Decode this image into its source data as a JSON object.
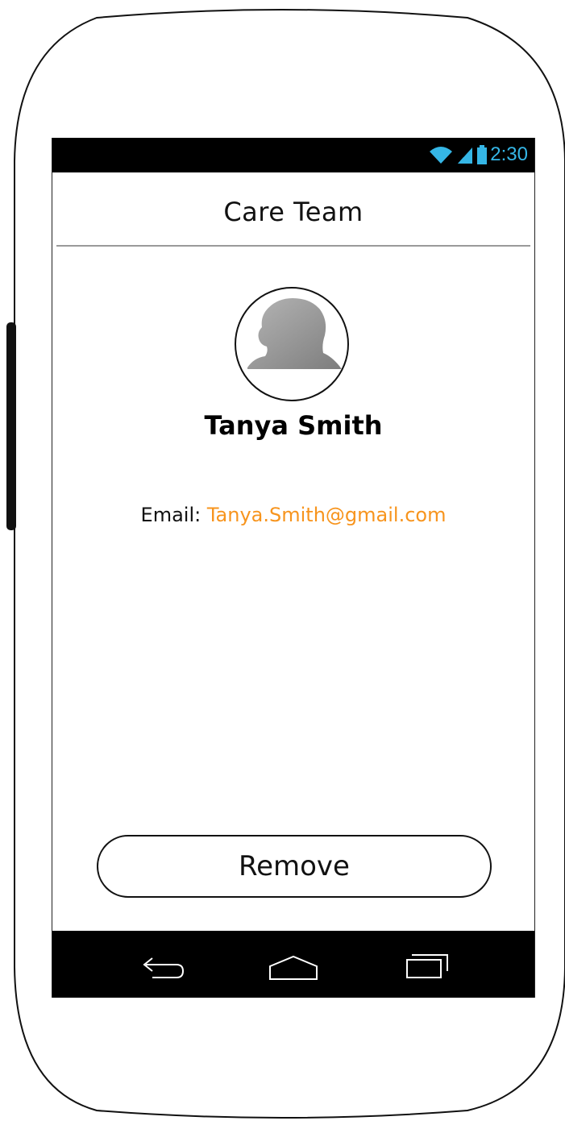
{
  "status_bar": {
    "time": "2:30",
    "icons": [
      "wifi-icon",
      "signal-icon",
      "battery-icon"
    ],
    "accent_color": "#35b6e6"
  },
  "header": {
    "title": "Care Team"
  },
  "contact": {
    "avatar": "avatar-silhouette",
    "name": "Tanya Smith",
    "email_label": "Email:",
    "email_value": "Tanya.Smith@gmail.com",
    "link_color": "#f7941d"
  },
  "actions": {
    "remove_label": "Remove"
  },
  "nav_bar": {
    "icons": [
      "back-icon",
      "home-icon",
      "recent-apps-icon"
    ]
  }
}
